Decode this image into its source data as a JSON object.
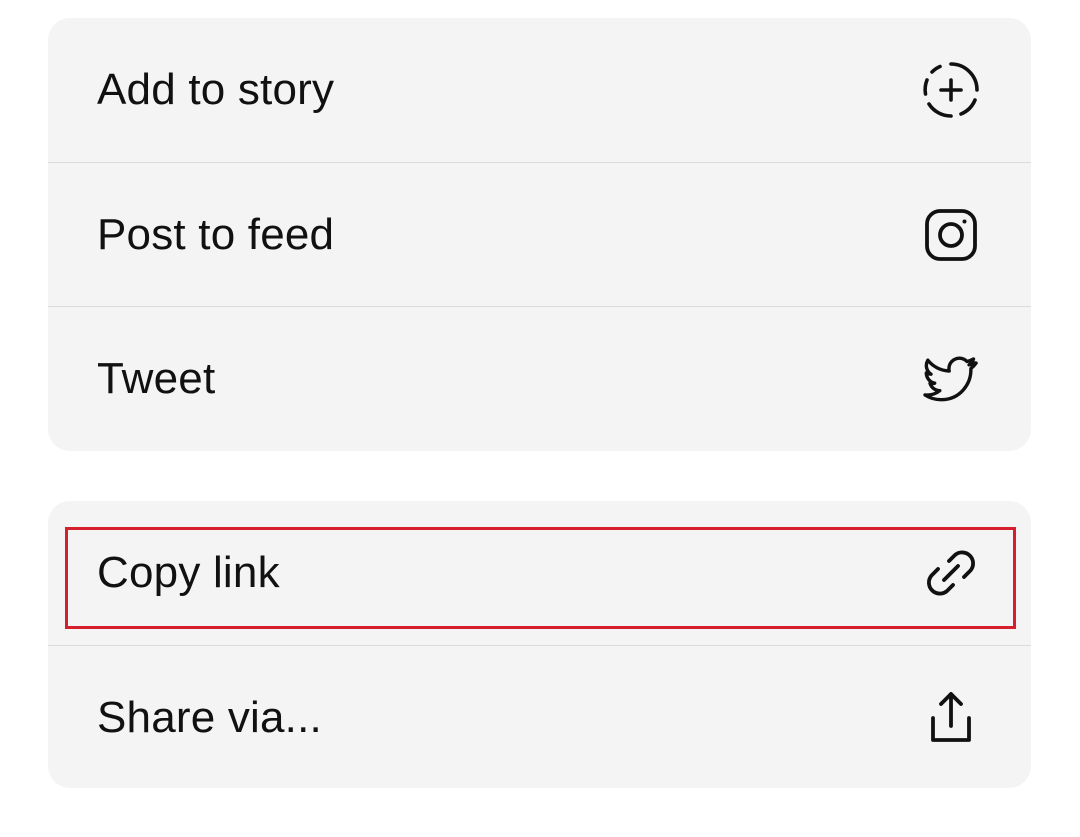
{
  "share_sheet": {
    "group_social": [
      {
        "label": "Add to story",
        "icon": "add-story-icon"
      },
      {
        "label": "Post to feed",
        "icon": "instagram-icon"
      },
      {
        "label": "Tweet",
        "icon": "twitter-icon"
      }
    ],
    "group_link": [
      {
        "label": "Copy link",
        "icon": "link-icon"
      },
      {
        "label": "Share via...",
        "icon": "share-icon"
      }
    ]
  },
  "colors": {
    "card_background": "#f4f4f4",
    "divider": "#dcdcdc",
    "text": "#111111",
    "highlight_border": "#d61f2c"
  },
  "highlighted_item": "Copy link"
}
